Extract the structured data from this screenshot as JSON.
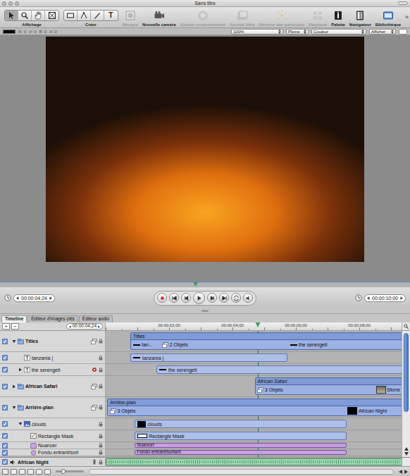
{
  "window": {
    "title": "Sans titre"
  },
  "toolbar": {
    "view_tools": {
      "label": "Affichage",
      "selected": [
        true,
        false,
        false,
        false
      ]
    },
    "create_tools": {
      "label": "Créer",
      "text_tool": "T",
      "selected": [
        false,
        false,
        false,
        false
      ]
    },
    "buttons": [
      {
        "label": "Masque",
        "disabled": true
      },
      {
        "label": "Nouvelle caméra",
        "disabled": false
      },
      {
        "label": "Ajouter comportement",
        "disabled": true
      },
      {
        "label": "Ajouter filtre",
        "disabled": true
      },
      {
        "label": "Générer des particules",
        "disabled": true
      },
      {
        "label": "Repiquer",
        "disabled": true
      },
      {
        "label": "Palette",
        "disabled": false
      },
      {
        "label": "Navigateur",
        "disabled": false
      },
      {
        "label": "Bibliothèque",
        "disabled": false
      }
    ],
    "overflow": "»"
  },
  "status_bar": {
    "swatch": "#000000",
    "readings": [
      "R: 0",
      "V: 0",
      "B: 0",
      "A: 0"
    ],
    "popups": [
      "100%",
      "Pleine",
      "Couleur",
      "Afficher"
    ]
  },
  "transport": {
    "current_time": "00:00:04;24",
    "duration": "00:00:10;00"
  },
  "tabs": [
    {
      "label": "Timeline",
      "selected": true
    },
    {
      "label": "Éditeur d'images clés",
      "selected": false
    },
    {
      "label": "Éditeur audio",
      "selected": false
    }
  ],
  "timeline": {
    "add": "+",
    "remove": "−",
    "timecode": "00:00:04;24",
    "playhead": 4.8,
    "ruler": [
      {
        "label": "00:00:02;00",
        "time": 2
      },
      {
        "label": "00:00:04;00",
        "time": 4
      },
      {
        "label": "00:00:06;00",
        "time": 6
      },
      {
        "label": "00:00:08;00",
        "time": 8
      }
    ],
    "layers": [
      {
        "name": "Titles",
        "kind": "group",
        "depth": 0,
        "enabled": true,
        "expandable": true,
        "expanded": true,
        "behavior": false,
        "clip": {
          "label": "Titles",
          "start": 0.78,
          "end": 10,
          "color": "#9db2e4",
          "items": [
            {
              "label": "tan...",
              "kind": "bar",
              "at": 0.85
            },
            {
              "label": "2 Objets",
              "kind": "count",
              "at": 1.75
            },
            {
              "label": "the serengeti",
              "kind": "bar",
              "at": 5.8
            }
          ]
        }
      },
      {
        "name": "tanzania |",
        "kind": "text",
        "depth": 1,
        "enabled": true,
        "expandable": false,
        "expanded": false,
        "behavior": false,
        "clip": {
          "label": "tanzania |",
          "start": 0.78,
          "end": 5.73,
          "color": "#aebfe8",
          "items": []
        }
      },
      {
        "name": "the serengeti",
        "kind": "text",
        "depth": 1,
        "enabled": true,
        "expandable": true,
        "expanded": false,
        "behavior": true,
        "clip": {
          "label": "the serengeti",
          "start": 1.6,
          "end": 10,
          "color": "#aebfe8",
          "items": []
        }
      },
      {
        "name": "African Safari",
        "kind": "group",
        "depth": 0,
        "enabled": true,
        "expandable": true,
        "expanded": false,
        "behavior": false,
        "clip": {
          "label": "African Safari",
          "start": 4.7,
          "end": 10,
          "color": "#9db2e4",
          "items": [
            {
              "label": "3 Objets",
              "kind": "count",
              "at": 4.75
            },
            {
              "label": "Stone",
              "kind": "photo",
              "at": 8.5
            }
          ]
        }
      },
      {
        "name": "Arrière-plan",
        "kind": "group",
        "depth": 0,
        "enabled": true,
        "expandable": true,
        "expanded": true,
        "behavior": false,
        "clip": {
          "label": "Arrière-plan",
          "start": 0.05,
          "end": 10,
          "color": "#9db2e4",
          "items": [
            {
              "label": "3 Objets",
              "kind": "count",
              "at": 0.1
            },
            {
              "label": "African Night",
              "kind": "swatch",
              "at": 7.6
            }
          ]
        }
      },
      {
        "name": "clouds",
        "kind": "image",
        "depth": 1,
        "enabled": true,
        "expandable": true,
        "expanded": true,
        "behavior": false,
        "clip": {
          "label": "clouds",
          "start": 0.9,
          "end": 7.6,
          "color": "#aebfe8",
          "items": []
        }
      },
      {
        "name": "Rectangle Mask",
        "kind": "mask",
        "depth": 2,
        "enabled": true,
        "expandable": false,
        "expanded": false,
        "behavior": false,
        "clip": {
          "label": "Rectangle Mask",
          "start": 0.9,
          "end": 7.6,
          "color": "#aebfe8",
          "items": []
        }
      },
      {
        "name": "Nuancer",
        "kind": "filter",
        "depth": 2,
        "enabled": true,
        "expandable": false,
        "expanded": false,
        "behavior": false,
        "clip": {
          "label": "Nuancer",
          "start": 0.9,
          "end": 7.6,
          "color": "#c6a0e2",
          "items": []
        }
      },
      {
        "name": "Fondu entrant/sort",
        "kind": "behavior",
        "depth": 2,
        "enabled": true,
        "expandable": false,
        "expanded": false,
        "behavior": false,
        "clip": {
          "label": "Fondu entrant/sortant",
          "start": 0.9,
          "end": 7.6,
          "color": "#c6a0e2",
          "items": []
        }
      }
    ],
    "audio": {
      "name": "African Night",
      "enabled": true,
      "clip": {
        "start": 0,
        "end": 10,
        "color": "#9fdcb4"
      }
    }
  }
}
